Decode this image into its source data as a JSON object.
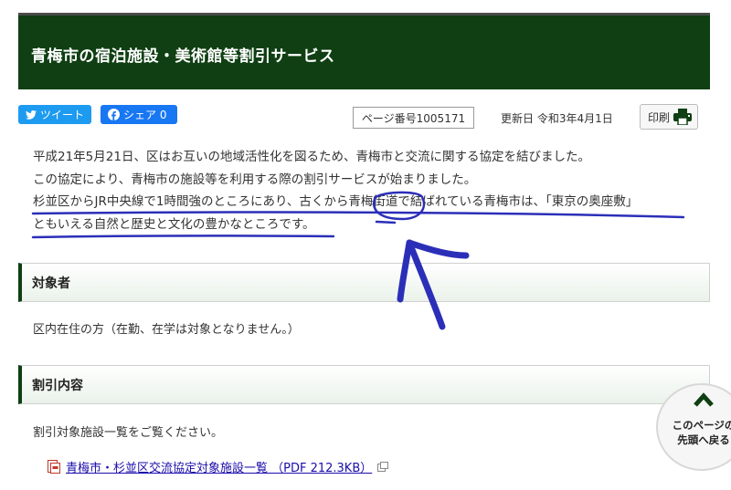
{
  "header": {
    "title": "青梅市の宿泊施設・美術館等割引サービス"
  },
  "social": {
    "tweet_label": "ツイート",
    "share_label": "シェア 0"
  },
  "meta": {
    "page_number": "ページ番号1005171",
    "updated": "更新日 令和3年4月1日",
    "print_label": "印刷"
  },
  "intro": {
    "line1": "平成21年5月21日、区はお互いの地域活性化を図るため、青梅市と交流に関する協定を結びました。",
    "line2": "この協定により、青梅市の施設等を利用する際の割引サービスが始まりました。",
    "line3": "杉並区からJR中央線で1時間強のところにあり、古くから青梅街道で結ばれている青梅市は、「東京の奥座敷」",
    "line4": "ともいえる自然と歴史と文化の豊かなところです。"
  },
  "sections": [
    {
      "heading": "対象者",
      "body": "区内在住の方（在勤、在学は対象となりません。）"
    },
    {
      "heading": "割引内容",
      "body": "割引対象施設一覧をご覧ください。"
    }
  ],
  "pdf_link": {
    "label": "青梅市・杉並区交流協定対象施設一覧 （PDF 212.3KB）"
  },
  "back_to_top": {
    "line1": "このページの",
    "line2": "先頭へ戻る"
  },
  "colors": {
    "header_bg": "#0f3f12",
    "annotation_ink": "#2b2fb8",
    "tweet": "#1d9bf0",
    "share": "#1877f2"
  }
}
